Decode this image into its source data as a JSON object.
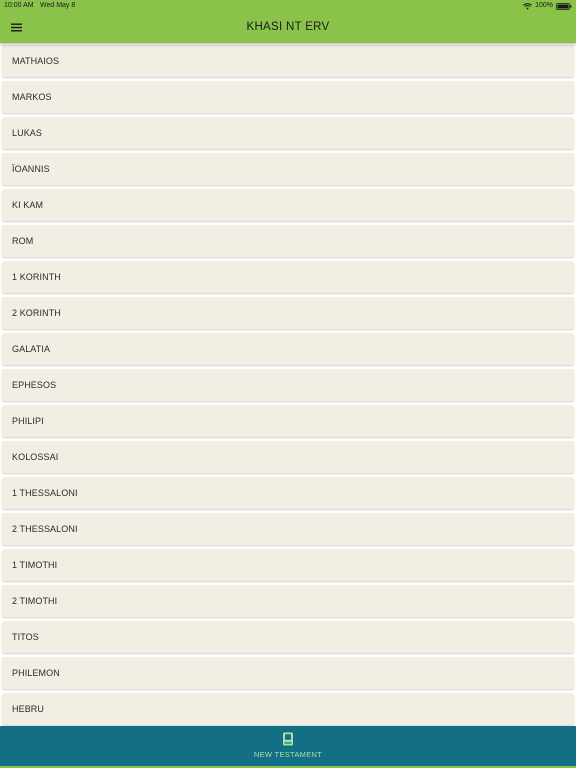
{
  "status_bar": {
    "time": "10:00 AM",
    "date": "Wed May 8",
    "battery": "100%"
  },
  "app_bar": {
    "title": "KHASI NT ERV",
    "menu_icon": "hamburger-menu-icon"
  },
  "books": [
    "MATHAIOS",
    "MARKOS",
    "LUKAS",
    "ÏOANNIS",
    "KI KAM",
    "ROM",
    "1 KORINTH",
    "2 KORINTH",
    "GALATIA",
    "EPHESOS",
    "PHILIPI",
    "KOLOSSAI",
    "1 THESSALONI",
    "2 THESSALONI",
    "1 TIMOTHI",
    "2 TIMOTHI",
    "TITOS",
    "PHILEMON",
    "HEBRU"
  ],
  "bottom_nav": {
    "tab_label": "NEW TESTAMENT",
    "tab_icon": "book-icon"
  },
  "colors": {
    "app_bar": "#8bc34a",
    "list_item": "#f2eee4",
    "bottom_nav": "#136f85",
    "tab_active": "#a8e0a0"
  }
}
